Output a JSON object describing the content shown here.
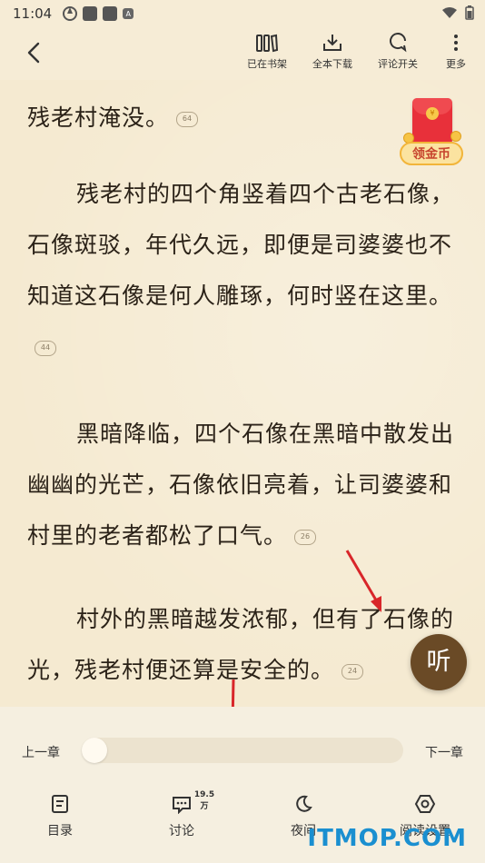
{
  "status_bar": {
    "time": "11:04",
    "sim_icon": "A"
  },
  "toolbar": {
    "bookshelf_label": "已在书架",
    "download_label": "全本下载",
    "comment_toggle_label": "评论开关",
    "more_label": "更多"
  },
  "reader": {
    "paragraphs": [
      {
        "text": "残老村淹没。",
        "comments": "64"
      },
      {
        "text": "残老村的四个角竖着四个古老石像，石像斑驳，年代久远，即便是司婆婆也不知道这石像是何人雕琢，何时竖在这里。",
        "comments": "44"
      },
      {
        "text": "黑暗降临，四个石像在黑暗中散发出幽幽的光芒，石像依旧亮着，让司婆婆和村里的老者都松了口气。",
        "comments": "26"
      },
      {
        "text": "村外的黑暗越发浓郁，但有了石像的光，残老村便还算是安全的。",
        "comments": "24"
      }
    ],
    "coin_label": "领金币",
    "listen_label": "听"
  },
  "progress": {
    "prev_chapter": "上一章",
    "next_chapter": "下一章",
    "position": 0.0
  },
  "bottom_nav": {
    "toc": "目录",
    "discuss": "讨论",
    "discuss_count": "19.5万",
    "night": "夜间",
    "settings": "阅读设置"
  },
  "watermark": "ITMOP.COM",
  "colors": {
    "page_bg": "#f5ead1",
    "listen_button": "#6a4a26",
    "arrow": "#d8262a",
    "watermark": "#1a8fd0"
  }
}
